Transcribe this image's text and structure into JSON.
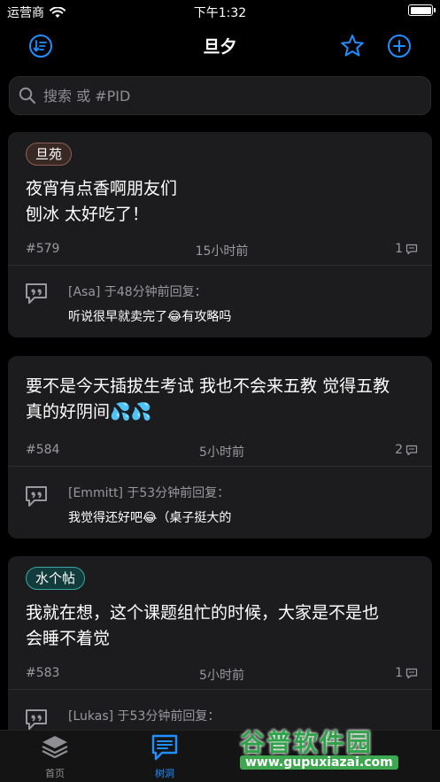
{
  "status_bar": {
    "carrier": "运营商",
    "time": "下午1:32"
  },
  "nav": {
    "title": "旦夕"
  },
  "search": {
    "placeholder": "搜索 或 #PID"
  },
  "posts": [
    {
      "tag": "旦苑",
      "lines": [
        "夜宵有点香啊朋友们",
        "刨冰 太好吃了！"
      ],
      "pid": "#579",
      "time": "15小时前",
      "reply_count": "1",
      "reply": {
        "header": "[Asa] 于48分钟前回复：",
        "text": "听说很早就卖完了😂有攻略吗"
      }
    },
    {
      "lines": [
        "要不是今天插拔生考试 我也不会来五教 觉得五教",
        "真的好阴间💦💦"
      ],
      "pid": "#584",
      "time": "5小时前",
      "reply_count": "2",
      "reply": {
        "header": "[Emmitt] 于53分钟前回复：",
        "text": "我觉得还好吧😂（桌子挺大的"
      }
    },
    {
      "tag": "水个帖",
      "lines": [
        "我就在想，这个课题组忙的时候，大家是不是也",
        "会睡不着觉"
      ],
      "pid": "#583",
      "time": "5小时前",
      "reply_count": "1",
      "reply": {
        "header": "[Lukas] 于53分钟前回复："
      }
    }
  ],
  "tabs": [
    {
      "label": "首页",
      "active": false
    },
    {
      "label": "树洞",
      "active": true
    }
  ],
  "watermark": {
    "title": "谷普软件园",
    "url": "www.gupuxiazai.com"
  },
  "colors": {
    "accent": "#1e90ff",
    "background": "#000000",
    "card": "#1c1c1e",
    "muted": "#9a9a9e"
  }
}
